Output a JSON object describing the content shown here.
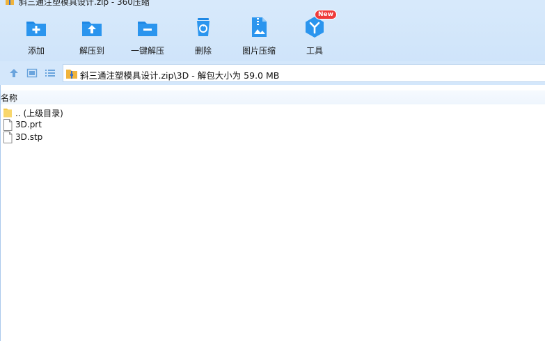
{
  "window": {
    "title": "斜三通注塑模具设计.zip - 360压缩"
  },
  "toolbar": {
    "items": [
      {
        "label": "添加",
        "icon": "add-folder-icon"
      },
      {
        "label": "解压到",
        "icon": "extract-to-icon"
      },
      {
        "label": "一键解压",
        "icon": "one-click-extract-icon"
      },
      {
        "label": "删除",
        "icon": "delete-icon"
      },
      {
        "label": "图片压缩",
        "icon": "image-compress-icon"
      },
      {
        "label": "工具",
        "icon": "tools-icon",
        "badge": "New"
      }
    ]
  },
  "address": {
    "path": "斜三通注塑模具设计.zip\\3D - 解包大小为 59.0 MB",
    "icons": [
      "up-arrow-icon",
      "thumbnail-view-icon",
      "list-view-icon",
      "zip-archive-icon"
    ]
  },
  "file_list": {
    "column_header": "名称",
    "rows": [
      {
        "name": ".. (上级目录)",
        "icon": "folder-icon"
      },
      {
        "name": "3D.prt",
        "icon": "file-icon"
      },
      {
        "name": "3D.stp",
        "icon": "file-icon"
      }
    ]
  },
  "colors": {
    "toolbar_bg": "#d7e9fb",
    "icon_blue": "#1e88e5",
    "badge_red": "#ef3b3b",
    "folder_yellow": "#f5c94a"
  }
}
